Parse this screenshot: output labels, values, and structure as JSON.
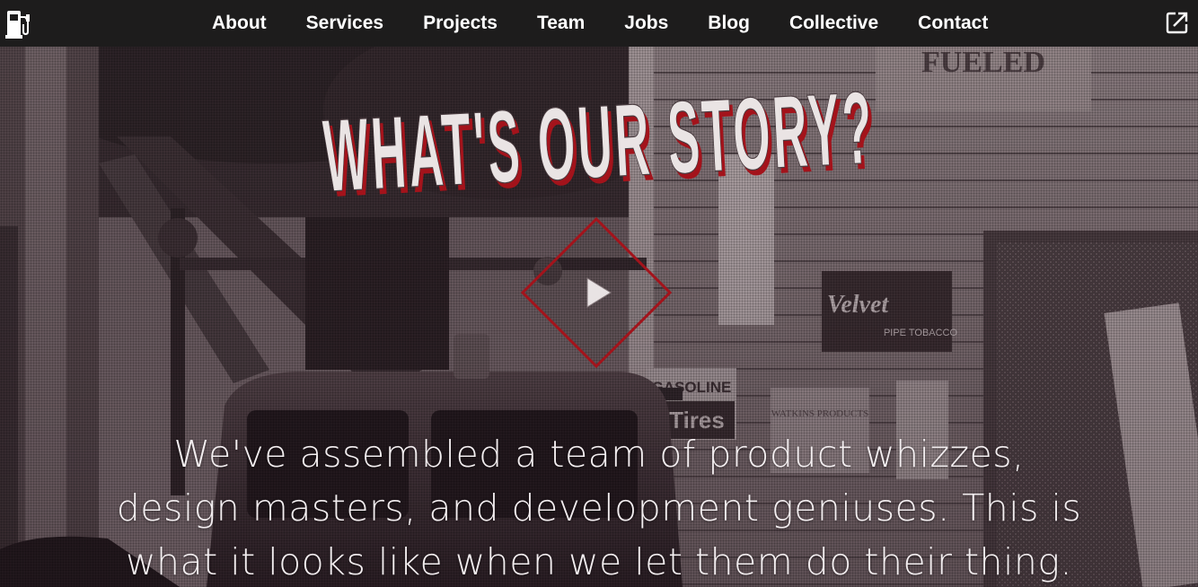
{
  "nav": {
    "logo_icon": "gas-pump-icon",
    "links": [
      {
        "label": "About"
      },
      {
        "label": "Services"
      },
      {
        "label": "Projects"
      },
      {
        "label": "Team"
      },
      {
        "label": "Jobs"
      },
      {
        "label": "Blog"
      },
      {
        "label": "Collective"
      },
      {
        "label": "Contact"
      }
    ],
    "share_icon": "external-link-icon"
  },
  "hero": {
    "title": "WHAT'S OUR STORY?",
    "play_icon": "play-icon",
    "background_signs": {
      "store_sign": "FUELED",
      "gasoline_sign": "GASOLINE",
      "tires_sign": "Tires",
      "velvet_sign_brand": "Velvet",
      "velvet_sign_text": "PIPE TOBACCO",
      "watkins_sign": "WATKINS PRODUCTS"
    },
    "copy_lines": [
      "We've assembled a team of product whizzes,",
      "design masters, and development geniuses. This is",
      "what it looks like when we let them do their thing."
    ]
  },
  "colors": {
    "navbar_bg": "#1d1c1c",
    "accent_red": "#a3131b",
    "text_light": "#f3eef0",
    "photo_tint": "#4a4043"
  }
}
